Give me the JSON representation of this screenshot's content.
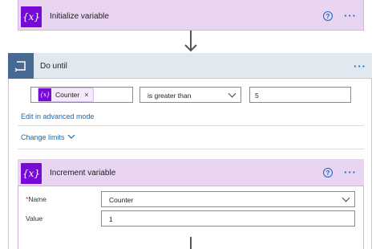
{
  "init_card": {
    "title": "Initialize variable",
    "icon": "variable-icon"
  },
  "do_until": {
    "title": "Do until",
    "icon": "loop-icon",
    "condition": {
      "token_label": "Counter",
      "operator": "is greater than",
      "value": "5"
    },
    "edit_advanced_label": "Edit in advanced mode",
    "change_limits_label": "Change limits"
  },
  "increment_card": {
    "title": "Increment variable",
    "icon": "variable-icon",
    "name_label": "Name",
    "name_required_marker": "*",
    "name_value": "Counter",
    "value_label": "Value",
    "value_value": "1"
  },
  "colors": {
    "variable_purple": "#770bd6",
    "card_header": "#e9d4f2",
    "loop_blue": "#486991",
    "link_blue": "#0f6cbd"
  }
}
